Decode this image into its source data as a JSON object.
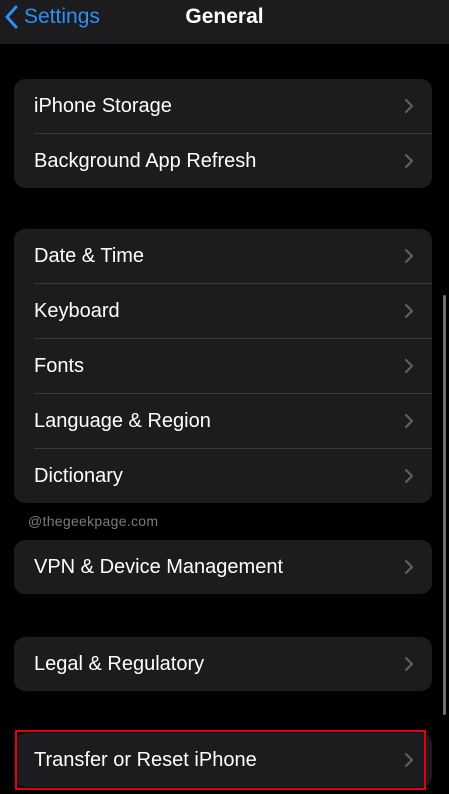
{
  "navbar": {
    "back_label": "Settings",
    "title": "General"
  },
  "groups": [
    {
      "items": [
        {
          "label": "iPhone Storage"
        },
        {
          "label": "Background App Refresh"
        }
      ]
    },
    {
      "items": [
        {
          "label": "Date & Time"
        },
        {
          "label": "Keyboard"
        },
        {
          "label": "Fonts"
        },
        {
          "label": "Language & Region"
        },
        {
          "label": "Dictionary"
        }
      ]
    },
    {
      "items": [
        {
          "label": "VPN & Device Management"
        }
      ]
    },
    {
      "items": [
        {
          "label": "Legal & Regulatory"
        }
      ]
    },
    {
      "items": [
        {
          "label": "Transfer or Reset iPhone"
        }
      ]
    }
  ],
  "watermark": "@thegeekpage.com",
  "icons": {
    "back": "chevron-left-icon",
    "disclosure": "chevron-right-icon"
  },
  "colors": {
    "accent": "#2f8ff5",
    "background": "#000000",
    "cell": "#1c1c1e",
    "highlight": "#e3000f"
  }
}
